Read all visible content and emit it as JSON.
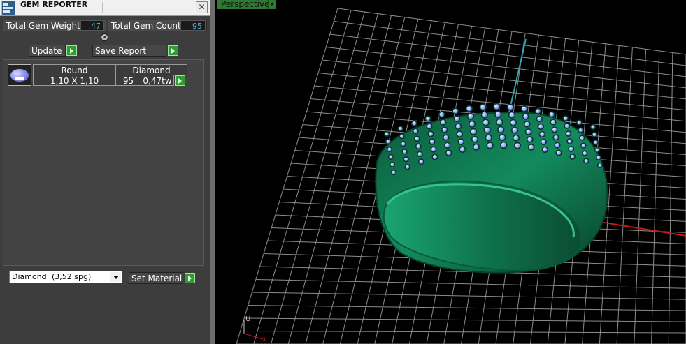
{
  "panel": {
    "title": "GEM REPORTER",
    "close_glyph": "✕",
    "total_weight_label": "Total Gem Weight",
    "total_weight_value": ",47",
    "total_count_label": "Total Gem Count",
    "total_count_value": "95",
    "update_label": "Update",
    "save_label": "Save Report",
    "gem_row": {
      "shape": "Round",
      "material": "Diamond",
      "size": "1,10 X 1,10",
      "count": "95",
      "weight": "0,47tw"
    },
    "material_select": {
      "name": "Diamond",
      "spg": "(3,52 spg)"
    },
    "set_material_label": "Set Material"
  },
  "viewport": {
    "view_name": "Perspective",
    "axis_u": "U",
    "axis_x": "x",
    "colors": {
      "grid": "#8c8c8c",
      "axis_red": "#c81818",
      "axis_cyan": "#2aa7b8",
      "ring": "#0f6a48",
      "gem": "#8fa8ff"
    }
  }
}
